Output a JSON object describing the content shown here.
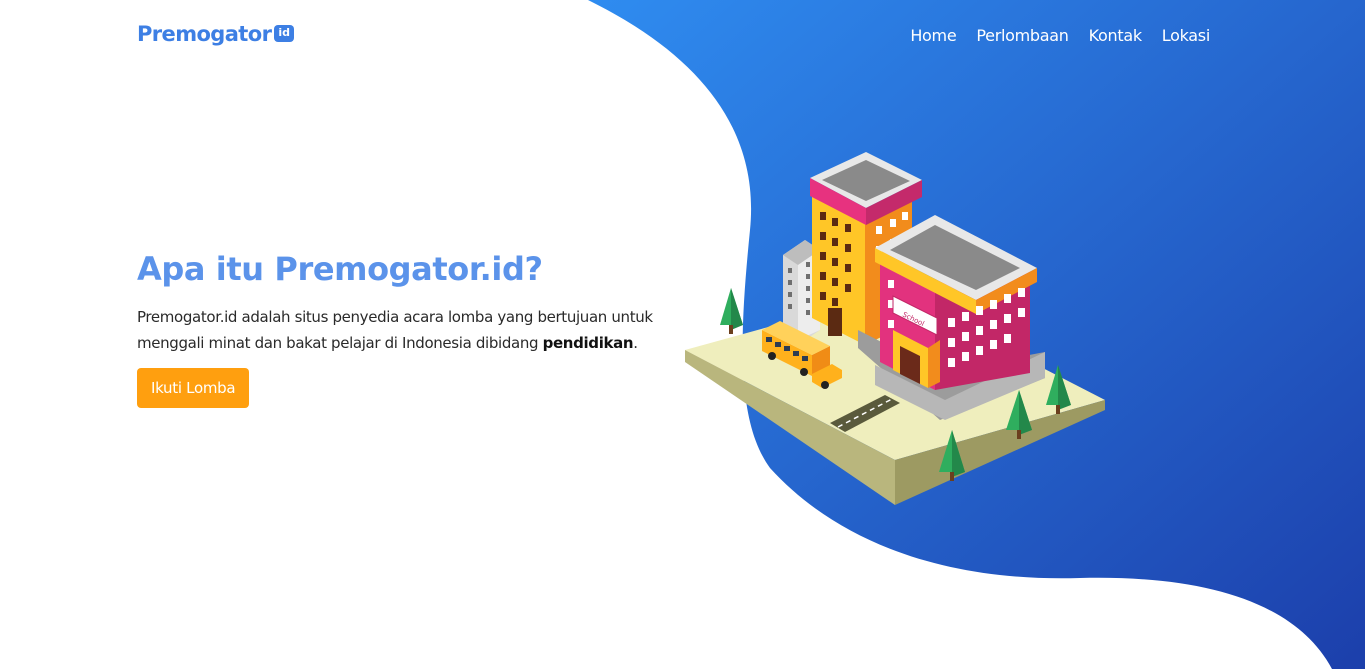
{
  "brand": {
    "name": "Premogator",
    "badge": "id"
  },
  "nav": {
    "items": [
      {
        "label": "Home"
      },
      {
        "label": "Perlombaan"
      },
      {
        "label": "Kontak"
      },
      {
        "label": "Lokasi"
      }
    ]
  },
  "hero": {
    "title": "Apa itu Premogator.id?",
    "description": "Premogator.id adalah situs penyedia acara lomba yang bertujuan untuk menggali minat dan bakat pelajar di Indonesia dibidang",
    "highlight": "pendidikan",
    "suffix": ".",
    "cta_label": "Ikuti Lomba"
  },
  "illustration": {
    "sign_text": "School"
  },
  "colors": {
    "brand_blue": "#3d7fe4",
    "title_blue": "#5b93ea",
    "gradient_start": "#2f8cf0",
    "gradient_end": "#1c3fab",
    "cta_orange": "#ff9f0f"
  }
}
